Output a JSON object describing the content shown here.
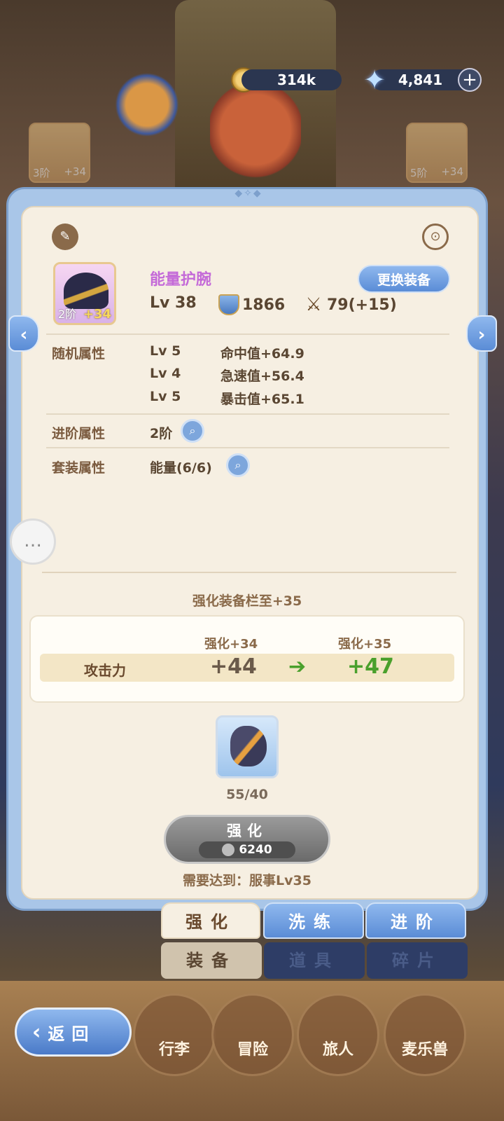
{
  "currency": {
    "gold": "314k",
    "gems": "4,841"
  },
  "side_equips": {
    "left": {
      "grade": "3阶",
      "plus": "+34"
    },
    "right": {
      "grade": "5阶",
      "plus": "+34"
    }
  },
  "equipment": {
    "name": "能量护腕",
    "grade": "2阶",
    "plus": "+34",
    "level": "Lv 38",
    "defense": "1866",
    "attack": "79(+15)",
    "change_label": "更换装备"
  },
  "random_attrs": {
    "label": "随机属性",
    "rows": [
      {
        "lv": "Lv 5",
        "value": "命中值+64.9"
      },
      {
        "lv": "Lv 4",
        "value": "急速值+56.4"
      },
      {
        "lv": "Lv 5",
        "value": "暴击值+65.1"
      }
    ]
  },
  "advance_attr": {
    "label": "进阶属性",
    "value": "2阶"
  },
  "set_attr": {
    "label": "套装属性",
    "value": "能量(6/6)"
  },
  "enhance": {
    "title": "强化装备栏至+35",
    "current_label": "强化+34",
    "next_label": "强化+35",
    "attr_name": "攻击力",
    "current_value": "+44",
    "next_value": "+47",
    "material_count": "55/40",
    "button_label": "强化",
    "cost": "6240",
    "requirement": "需要达到：服事Lv35"
  },
  "tabs": [
    "强化",
    "洗练",
    "进阶"
  ],
  "subtabs": [
    "装备",
    "道具",
    "碎片"
  ],
  "bottom_nav": [
    "行李",
    "冒险",
    "旅人",
    "麦乐兽"
  ],
  "back_label": "返回"
}
